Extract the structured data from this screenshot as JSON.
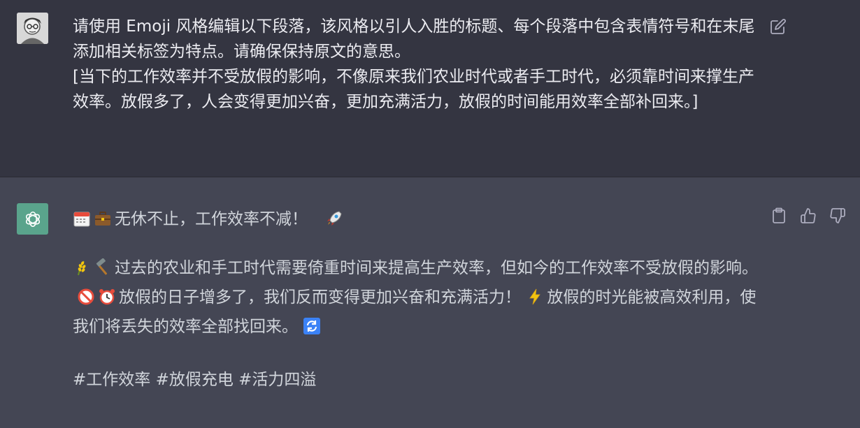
{
  "user_message": {
    "paragraph1": "请使用 Emoji 风格编辑以下段落，该风格以引人入胜的标题、每个段落中包含表情符号和在末尾添加相关标签为特点。请确保保持原文的意思。",
    "paragraph2": "[当下的工作效率并不受放假的影响，不像原来我们农业时代或者手工时代，必须靠时间来撑生产效率。放假多了，人会变得更加兴奋，更加充满活力，放假的时间能用效率全部补回来。]"
  },
  "assistant_message": {
    "title": "无休不止，工作效率不减！",
    "body_part1": "过去的农业和手工时代需要倚重时间来提高生产效率，但如今的工作效率不受放假的影响。",
    "body_part2": "放假的日子增多了，我们反而变得更加兴奋和充满活力！",
    "body_part3": "放假的时光能被高效利用，使我们将丢失的效率全部找回来。",
    "tags": "#工作效率 #放假充电 #活力四溢"
  },
  "icons": {
    "edit": "edit-icon",
    "copy": "clipboard-icon",
    "thumbs_up": "thumbs-up-icon",
    "thumbs_down": "thumbs-down-icon",
    "calendar": "calendar-emoji",
    "briefcase": "briefcase-emoji",
    "rocket": "rocket-emoji",
    "rice": "rice-emoji",
    "hammer": "hammer-emoji",
    "no_entry": "prohibited-emoji",
    "alarm": "alarm-clock-emoji",
    "lightning": "lightning-emoji",
    "refresh": "refresh-emoji"
  },
  "colors": {
    "user_bg": "#343541",
    "assistant_bg": "#444654",
    "assistant_avatar": "#5aa48c",
    "text": "#ececf1"
  }
}
